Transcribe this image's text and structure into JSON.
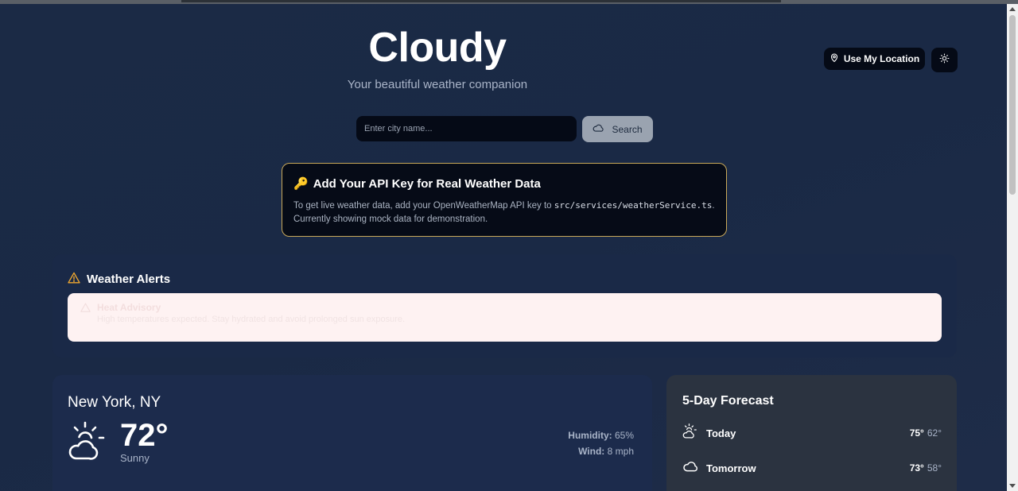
{
  "app": {
    "title": "Cloudy",
    "subtitle": "Your beautiful weather companion"
  },
  "header": {
    "location_label": "Use My Location",
    "location_icon": "map-pin-icon",
    "theme_icon": "sun-icon"
  },
  "search": {
    "placeholder": "Enter city name...",
    "value": "",
    "button_label": "Search",
    "button_icon": "cloud-icon"
  },
  "api_notice": {
    "icon": "🔑",
    "title": "Add Your API Key for Real Weather Data",
    "text_before": "To get live weather data, add your OpenWeatherMap API key to ",
    "code": "src/services/weatherService.ts",
    "text_after": ".",
    "text_line2": "Currently showing mock data for demonstration.",
    "border_color": "#c9a95a"
  },
  "alerts": {
    "title": "Weather Alerts",
    "title_icon": "warning-icon",
    "items": [
      {
        "title": "Heat Advisory",
        "description": "High temperatures expected. Stay hydrated and avoid prolonged sun exposure."
      }
    ]
  },
  "current": {
    "city": "New York, NY",
    "temperature": "72°",
    "condition": "Sunny",
    "icon": "partly-cloudy-icon",
    "humidity_label": "Humidity:",
    "humidity_value": "65%",
    "wind_label": "Wind:",
    "wind_value": "8 mph"
  },
  "forecast": {
    "title": "5-Day Forecast",
    "days": [
      {
        "day": "Today",
        "high": "75°",
        "low": "62°",
        "icon": "partly-cloudy-icon"
      },
      {
        "day": "Tomorrow",
        "high": "73°",
        "low": "58°",
        "icon": "cloud-icon"
      }
    ]
  }
}
